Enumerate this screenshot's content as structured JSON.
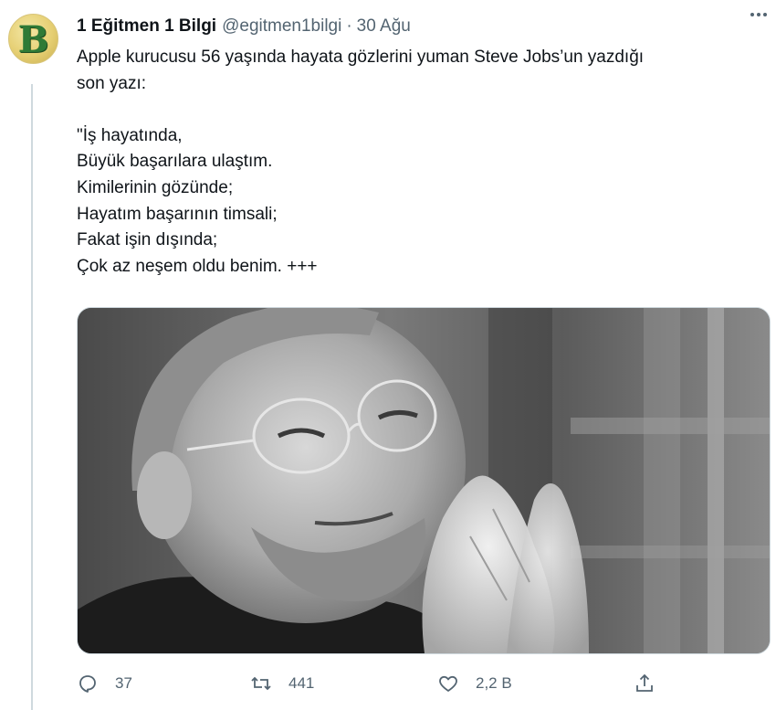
{
  "tweet": {
    "avatar_letter": "B",
    "author_name": "1 Eğitmen 1 Bilgi",
    "handle": "@egitmen1bilgi",
    "separator": "·",
    "date": "30 Ağu",
    "text": "Apple kurucusu 56 yaşında hayata gözlerini yuman Steve Jobs’un yazdığı\nson yazı:\n\n\"İş hayatında,\nBüyük başarılara ulaştım.\nKimilerinin gözünde;\nHayatım başarının timsali;\nFakat işin dışında;\nÇok az neşem oldu benim. +++",
    "media_description": "Black and white photo of Steve Jobs with glasses, hands pressed together",
    "actions": {
      "reply_count": "37",
      "retweet_count": "441",
      "like_count": "2,2 B"
    }
  },
  "colors": {
    "text_primary": "#0f1419",
    "text_secondary": "#536471",
    "border": "#cfd9de",
    "avatar_bg": "#e6cf73",
    "avatar_letter": "#2f7a36"
  },
  "icons": {
    "more": "more-horizontal-icon",
    "reply": "comment-bubble-icon",
    "retweet": "retweet-icon",
    "like": "heart-icon",
    "share": "share-icon"
  }
}
